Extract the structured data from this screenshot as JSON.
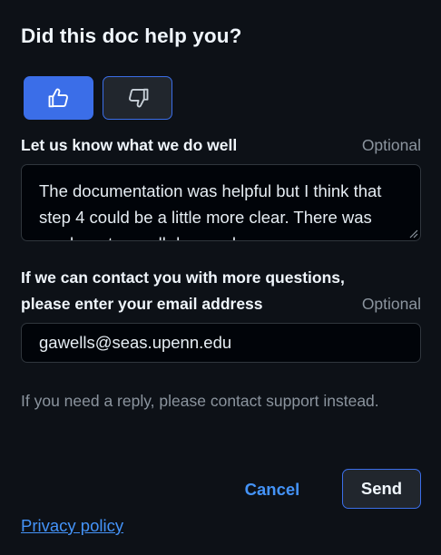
{
  "title": "Did this doc help you?",
  "votes": {
    "up_icon": "thumbs-up-icon",
    "down_icon": "thumbs-down-icon",
    "selected": "up"
  },
  "feedback": {
    "label": "Let us know what we do well",
    "optional": "Optional",
    "value": "The documentation was helpful but I think that step 4 could be a little more clear. There was nowhere to scroll down, when"
  },
  "email": {
    "label_line1": "If we can contact you with more questions,",
    "label_line2": "please enter your email address",
    "optional": "Optional",
    "value": "gawells@seas.upenn.edu"
  },
  "note": "If you need a reply, please contact support instead.",
  "actions": {
    "cancel_label": "Cancel",
    "send_label": "Send"
  },
  "privacy_label": "Privacy policy",
  "colors": {
    "background": "#0d1117",
    "accent": "#3b6ee8",
    "link": "#4493f8",
    "muted": "#8b949e"
  }
}
